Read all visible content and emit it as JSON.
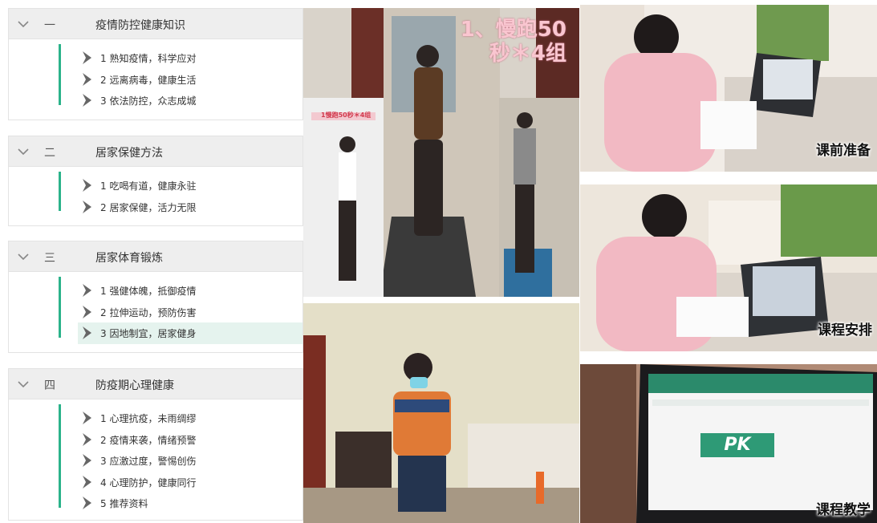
{
  "sections": [
    {
      "number": "一",
      "title": "疫情防控健康知识",
      "items": [
        {
          "label": "1  熟知疫情，科学应对",
          "active": false
        },
        {
          "label": "2  远离病毒，健康生活",
          "active": false
        },
        {
          "label": "3  依法防控，众志成城",
          "active": false
        }
      ]
    },
    {
      "number": "二",
      "title": "居家保健方法",
      "items": [
        {
          "label": "1  吃喝有道，健康永驻",
          "active": false
        },
        {
          "label": "2  居家保健，活力无限",
          "active": false
        }
      ]
    },
    {
      "number": "三",
      "title": "居家体育锻炼",
      "items": [
        {
          "label": "1  强健体魄，抵御疫情",
          "active": false
        },
        {
          "label": "2  拉伸运动，预防伤害",
          "active": false
        },
        {
          "label": "3  因地制宜，居家健身",
          "active": true
        }
      ]
    },
    {
      "number": "四",
      "title": "防疫期心理健康",
      "items": [
        {
          "label": "1  心理抗疫，未雨绸缪",
          "active": false
        },
        {
          "label": "2  疫情来袭，情绪预警",
          "active": false
        },
        {
          "label": "3  应激过度，警惕创伤",
          "active": false
        },
        {
          "label": "4  心理防护，健康同行",
          "active": false
        },
        {
          "label": "5  推荐资料",
          "active": false
        }
      ]
    }
  ],
  "photos": {
    "exercise_overlay_line1": "1、慢跑50",
    "exercise_overlay_line2": "秒＊4组",
    "exercise_small_label": "1慢跑50秒＊4组",
    "prep_caption": "课前准备",
    "schedule_caption": "课程安排",
    "teaching_caption": "课程教学",
    "pk_banner": "PK"
  },
  "colors": {
    "accent_green": "#2bb38a",
    "active_row_bg": "#e5f3ee",
    "header_bg": "#eeeeee"
  },
  "icons": {
    "section_toggle": "chevron-down-icon",
    "item_marker": "chevron-right-icon"
  }
}
